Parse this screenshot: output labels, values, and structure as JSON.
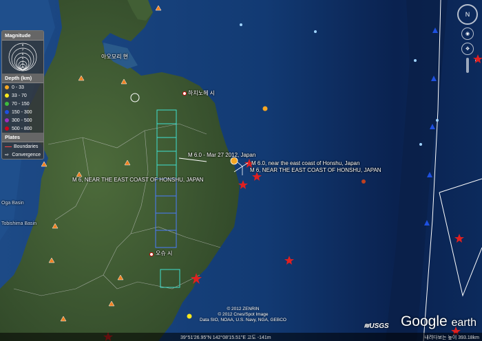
{
  "legend": {
    "magnitude_title": "Magnitude",
    "magnitude_scale": [
      "8",
      "7",
      "6",
      "5",
      "4",
      "3",
      "2"
    ],
    "depth_title": "Depth (km)",
    "depth_rows": [
      {
        "label": "0 - 33",
        "color": "#f5a623"
      },
      {
        "label": "33 - 70",
        "color": "#f8e71c"
      },
      {
        "label": "70 - 150",
        "color": "#3dbb3d"
      },
      {
        "label": "150 - 300",
        "color": "#1e50e0"
      },
      {
        "label": "300 - 500",
        "color": "#9b30c0"
      },
      {
        "label": "500 - 800",
        "color": "#d0021b"
      }
    ],
    "plates_title": "Plates",
    "plates_rows": [
      {
        "label": "Boundaries"
      },
      {
        "label": "Convergence"
      }
    ]
  },
  "places": {
    "aomori": "아오모리 현",
    "hachinohe": "하치노헤 시",
    "oshu": "오슈 시",
    "oga_basin": "Oga Basin",
    "tobishima_basin": "Tobishima Basin"
  },
  "quakes": [
    {
      "label": "M 6.0 - Mar 27 2012, Japan",
      "color": "#f5a623"
    },
    {
      "label": "M 6.0, near the east coast of Honshu, Japan",
      "color": "#d0021b"
    },
    {
      "label": "M 6, NEAR THE EAST COAST OF HONSHU, JAPAN",
      "color": "#d0021b"
    },
    {
      "label": "M 6, NEAR THE EAST COAST OF HONSHU, JAPAN",
      "color": "#d0021b"
    }
  ],
  "attribution": {
    "line1": "© 2012 ZENRIN",
    "line2": "© 2012 Cnes/Spot Image",
    "line3": "Data SIO, NOAA, U.S. Navy, NGA, GEBCO"
  },
  "status": {
    "coords": "39°51'26.95\"N 142°08'15.51\"E 고도 -141m",
    "eye_alt": "내려다보는 높이 393.18km"
  },
  "logos": {
    "usgs": "≋USGS",
    "google": "Google",
    "earth": "earth"
  },
  "colors": {
    "ocean_deep": "#0b2a5a",
    "ocean_shallow": "#1c4f8f",
    "land": "#3e5a32",
    "boundary": "#ffffff",
    "grid_cyan": "#40e0d0",
    "grid_blue": "#4a7bff"
  }
}
